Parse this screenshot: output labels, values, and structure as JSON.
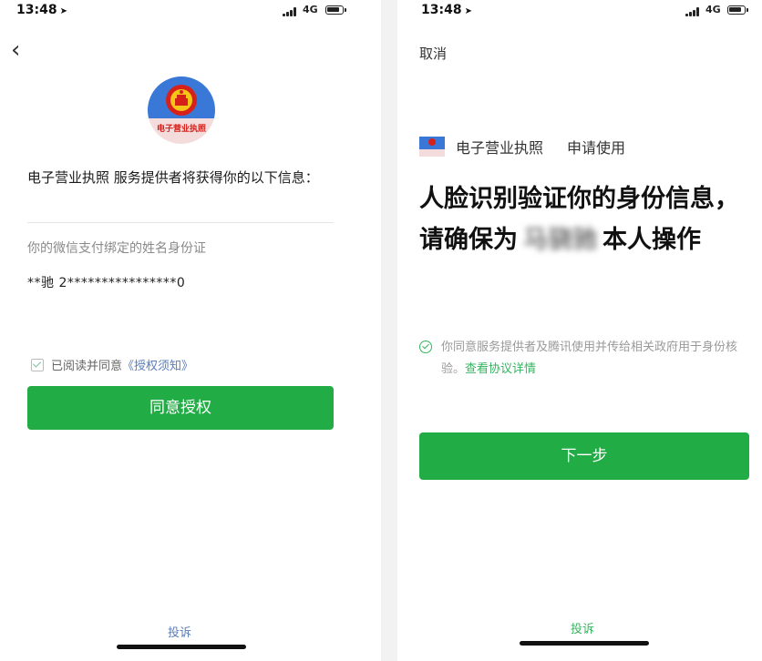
{
  "left": {
    "status": {
      "time": "13:48",
      "network": "4G"
    },
    "emblem_text": "电子营业执照",
    "heading": "电子营业执照 服务提供者将获得你的以下信息：",
    "info_label": "你的微信支付绑定的姓名身份证",
    "info_value": "**驰 2****************0",
    "agree_prefix": "已阅读并同意",
    "agree_link": "《授权须知》",
    "agree_button": "同意授权",
    "complaint": "投诉"
  },
  "right": {
    "status": {
      "time": "13:48",
      "network": "4G"
    },
    "cancel": "取消",
    "app_name": "电子营业执照",
    "app_action": "申请使用",
    "title_part1": "人脸识别验证你的身份信息，请确保为",
    "blurred_name": "马骁驰",
    "title_part2": "本人操作",
    "consent_text": "你同意服务提供者及腾讯使用并传给相关政府用于身份核验。",
    "consent_link": "查看协议详情",
    "next_button": "下一步",
    "complaint": "投诉"
  },
  "colors": {
    "primary_green": "#22ac45",
    "link_green": "#35b560",
    "link_blue": "#5a7db7"
  },
  "icons": [
    "navigation-icon",
    "signal-icon",
    "battery-icon",
    "back-chevron-icon",
    "national-emblem-icon",
    "checkbox-icon",
    "circle-check-icon"
  ]
}
